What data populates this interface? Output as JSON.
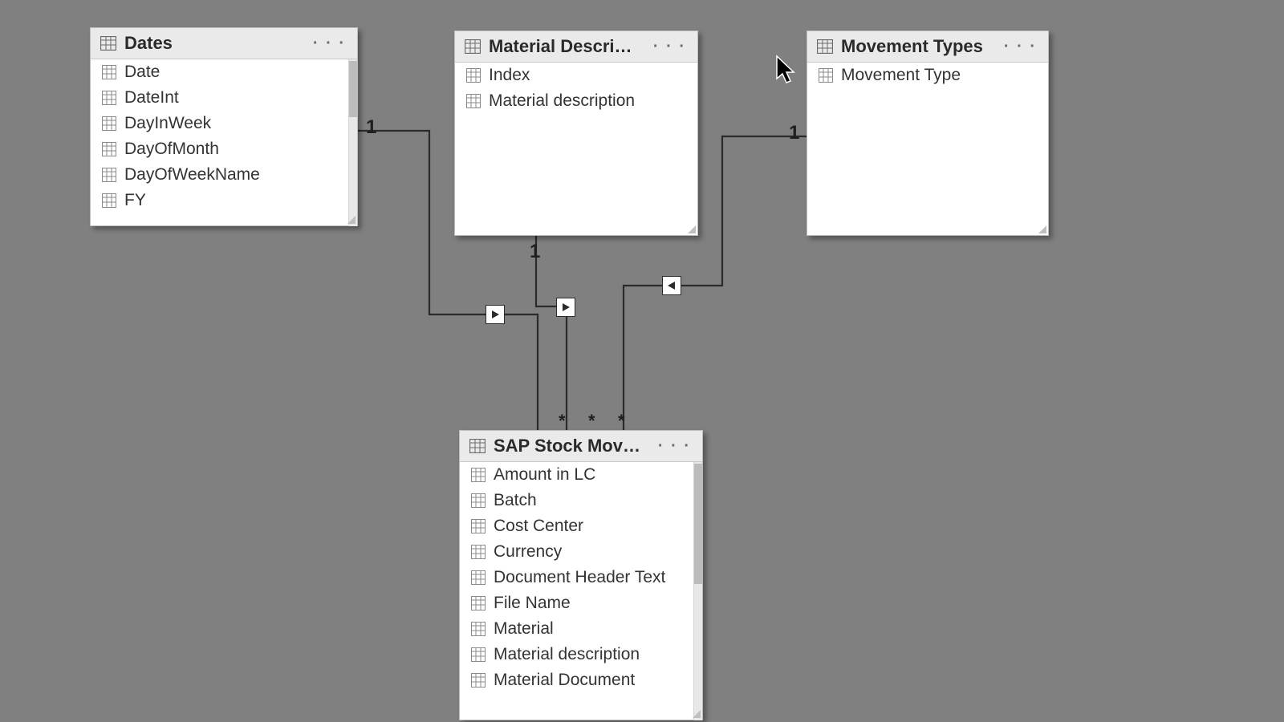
{
  "tables": {
    "dates": {
      "title": "Dates",
      "fields": [
        "Date",
        "DateInt",
        "DayInWeek",
        "DayOfMonth",
        "DayOfWeekName",
        "FY"
      ]
    },
    "material_desc": {
      "title": "Material Description",
      "fields": [
        "Index",
        "Material description"
      ]
    },
    "movement_types": {
      "title": "Movement Types",
      "fields": [
        "Movement Type"
      ]
    },
    "sap_stock": {
      "title": "SAP Stock Movements",
      "fields": [
        "Amount in LC",
        "Batch",
        "Cost Center",
        "Currency",
        "Document Header Text",
        "File Name",
        "Material",
        "Material description",
        "Material Document"
      ]
    }
  },
  "relationships": {
    "dates_to_sap": {
      "one": "1",
      "many": "*",
      "direction": "single"
    },
    "matdesc_to_sap": {
      "one": "1",
      "many": "*",
      "direction": "single"
    },
    "movement_to_sap": {
      "one": "1",
      "many": "*",
      "direction": "single"
    }
  },
  "ui": {
    "menu_dots": "· · ·"
  }
}
